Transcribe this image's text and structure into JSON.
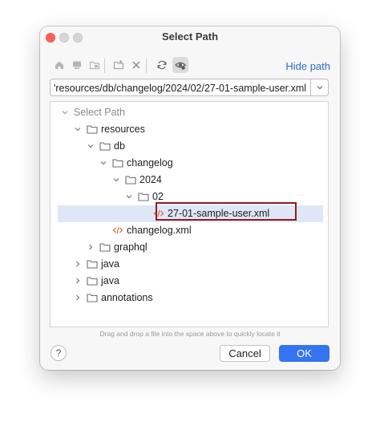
{
  "window": {
    "title": "Select Path"
  },
  "toolbar": {
    "hide_path_label": "Hide path",
    "icons": [
      "home-icon",
      "desktop-icon",
      "project-folder-icon",
      "new-folder-icon",
      "delete-icon",
      "refresh-icon",
      "show-hidden-icon"
    ]
  },
  "path": {
    "value": "'resources/db/changelog/2024/02/27-01-sample-user.xml"
  },
  "tree": {
    "root": "Select Path",
    "items": [
      {
        "label": "resources",
        "depth": 1,
        "expanded": true,
        "type": "folder"
      },
      {
        "label": "db",
        "depth": 2,
        "expanded": true,
        "type": "folder"
      },
      {
        "label": "changelog",
        "depth": 3,
        "expanded": true,
        "type": "folder"
      },
      {
        "label": "2024",
        "depth": 4,
        "expanded": true,
        "type": "folder"
      },
      {
        "label": "02",
        "depth": 5,
        "expanded": true,
        "type": "folder"
      },
      {
        "label": "27-01-sample-user.xml",
        "depth": 6,
        "type": "xml",
        "selected": true
      },
      {
        "label": "changelog.xml",
        "depth": 4,
        "type": "xml"
      },
      {
        "label": "graphql",
        "depth": 3,
        "expanded": false,
        "type": "folder"
      },
      {
        "label": "java",
        "depth": 1,
        "expanded": false,
        "type": "folder"
      },
      {
        "label": "java",
        "depth": 1,
        "expanded": false,
        "type": "folder"
      },
      {
        "label": "annotations",
        "depth": 1,
        "expanded": false,
        "type": "folder"
      }
    ]
  },
  "hint": "Drag and drop a file into the space above to quickly locate it",
  "footer": {
    "help": "?",
    "cancel_label": "Cancel",
    "ok_label": "OK"
  },
  "colors": {
    "accent": "#3574f0",
    "link": "#2f6bd1",
    "selection": "#dfe6f7",
    "highlight_box": "#8f1d1d",
    "xml_icon": "#d86a2b"
  }
}
